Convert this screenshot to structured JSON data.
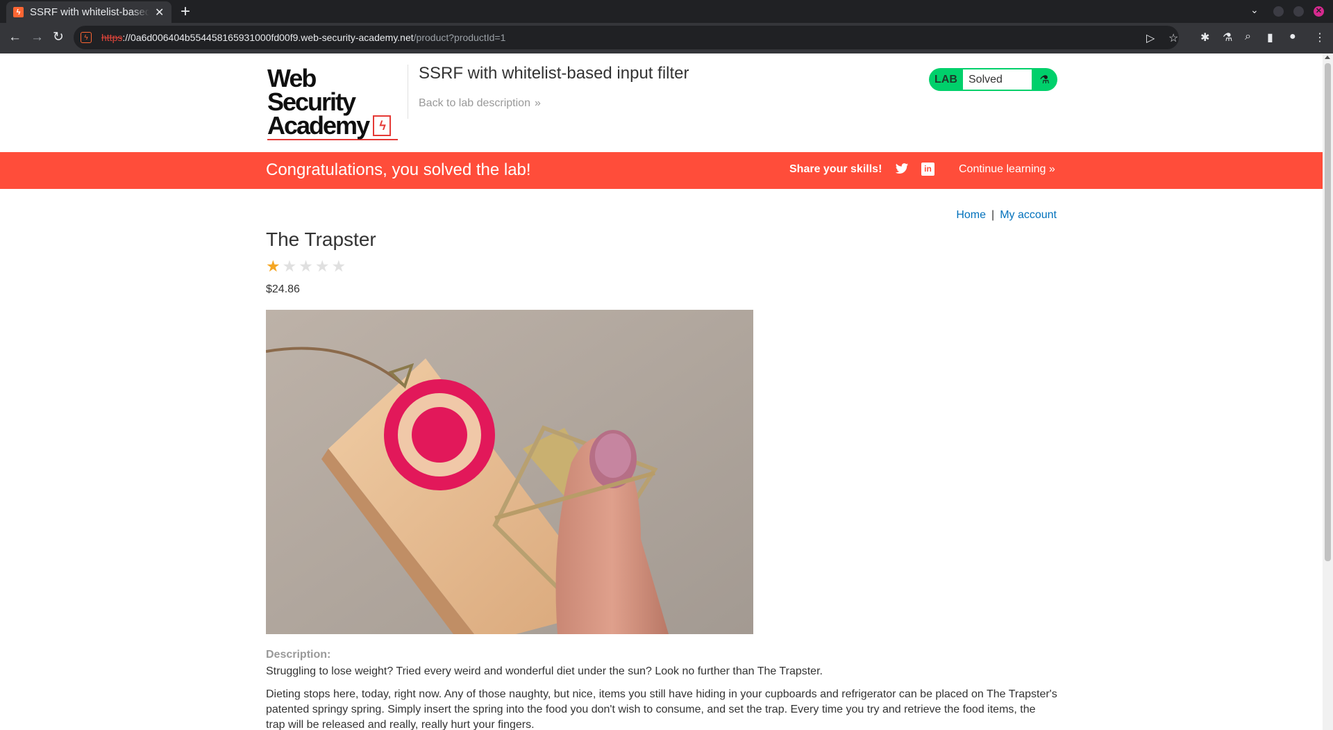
{
  "browser": {
    "tab_title": "SSRF with whitelist-based input filter",
    "url_scheme": "https",
    "url_host": "://0a6d006404b554458165931000fd00f9.web-security-academy.net",
    "url_path": "/product?productId=1"
  },
  "header": {
    "logo_line1": "Web Security",
    "logo_line2": "Academy",
    "lab_title": "SSRF with whitelist-based input filter",
    "back_link": "Back to lab description",
    "lab_badge": "LAB",
    "lab_status": "Solved"
  },
  "banner": {
    "message": "Congratulations, you solved the lab!",
    "share": "Share your skills!",
    "continue": "Continue learning"
  },
  "nav": {
    "home": "Home",
    "separator": "|",
    "account": "My account"
  },
  "product": {
    "title": "The Trapster",
    "rating": 1,
    "rating_max": 5,
    "price": "$24.86",
    "description_label": "Description:",
    "description_p1": "Struggling to lose weight? Tried every weird and wonderful diet under the sun? Look no further than The Trapster.",
    "description_p2": "Dieting stops here, today, right now. Any of those naughty, but nice, items you still have hiding in your cupboards and refrigerator can be placed on The Trapster's patented springy spring. Simply insert the spring into the food you don't wish to consume, and set the trap. Every time you try and retrieve the food items, the trap will be released and really, really hurt your fingers."
  },
  "colors": {
    "banner": "#ff4d3a",
    "lab_solved": "#00d06b",
    "link": "#0071bc",
    "star_on": "#f5a623"
  }
}
